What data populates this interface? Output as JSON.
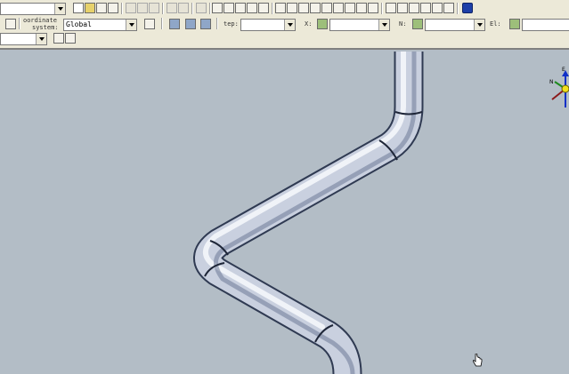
{
  "toolbar": {
    "row1": {
      "top_left_combo_value": ""
    },
    "row2": {
      "coordinate_label_line1": "oordinate",
      "coordinate_label_line2": "system:",
      "coordinate_value": "Global",
      "step_label": "tep:",
      "step_value": "",
      "x_label": "X:",
      "x_value": "",
      "n_label": "N:",
      "n_value": "",
      "el_label": "El:",
      "el_value": ""
    },
    "row3": {
      "left_combo_value": ""
    }
  },
  "viewport": {
    "background": "#b3bdc6",
    "pipe_color": "#dde3ee",
    "triad_labels": {
      "x": "N",
      "y": "E"
    }
  },
  "cursor": "hand-pointer"
}
